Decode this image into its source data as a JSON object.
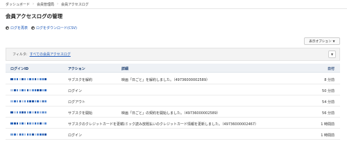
{
  "breadcrumb": [
    "ダッシュボード",
    "会員管理局",
    "会員アクセスログ"
  ],
  "page_title": "会員アクセスログの管理",
  "actions": {
    "reload": "ログを再表",
    "download": "ログをダウンロード(CSV)"
  },
  "view_options": "表示オプション",
  "filter": {
    "label": "フィルタ:",
    "value": "すべての会員アクセスログ"
  },
  "columns": {
    "login_id": "ログインID",
    "action": "アクション",
    "detail": "詳細",
    "date": "日付"
  },
  "rows": [
    {
      "action": "サブスクを解約",
      "detail": "映画「日ごと」を解約しました。（497360000025​89）",
      "date": "8 分前"
    },
    {
      "action": "ログイン",
      "detail": "",
      "date": "50 分前"
    },
    {
      "action": "ログアウト",
      "detail": "",
      "date": "54 分前"
    },
    {
      "action": "サブスクを開始",
      "detail": "映画「日ごと」の契約を開始しました。（497360000025​89）",
      "date": "56 分前"
    },
    {
      "action": "サブスクのクレジットカードを更新",
      "detail": "コミック読み放題払いのクレジットカード情報を更新しました。（497360000024​67）",
      "date": "1 時間前"
    },
    {
      "action": "ログイン",
      "detail": "",
      "date": "1 時間前"
    }
  ],
  "colors": {
    "link": "#1a56b8",
    "header_text": "#1a3c6e",
    "header_bg": "#eef1f5",
    "filter_bg": "#f3f3f3"
  }
}
